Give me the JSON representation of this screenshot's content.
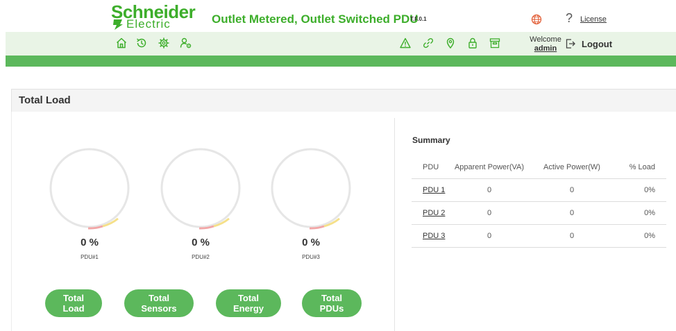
{
  "header": {
    "logo_line1": "Schneider",
    "logo_line2": "Electric",
    "product_title": "Outlet Metered, Outlet Switched PDU",
    "version": "T.F.0.1",
    "help_symbol": "?",
    "license_label": "License"
  },
  "nav": {
    "left_icons": [
      "home-icon",
      "history-icon",
      "settings-gear-icon",
      "user-settings-icon"
    ],
    "right_icons": [
      "alarm-warning-icon",
      "link-icon",
      "location-pin-icon",
      "lock-icon",
      "archive-icon"
    ],
    "welcome_label": "Welcome",
    "user": "admin",
    "logout_label": "Logout"
  },
  "panel": {
    "title": "Total Load"
  },
  "gauges": [
    {
      "value": "0 %",
      "label": "PDU#1"
    },
    {
      "value": "0 %",
      "label": "PDU#2"
    },
    {
      "value": "0 %",
      "label": "PDU#3"
    }
  ],
  "buttons": [
    {
      "line1": "Total",
      "line2": "Load"
    },
    {
      "line1": "Total",
      "line2": "Sensors"
    },
    {
      "line1": "Total",
      "line2": "Energy"
    },
    {
      "line1": "Total",
      "line2": "PDUs"
    }
  ],
  "summary": {
    "title": "Summary",
    "columns": [
      "PDU",
      "Apparent Power(VA)",
      "Active Power(W)",
      "% Load"
    ],
    "rows": [
      {
        "pdu": "PDU 1",
        "apparent": "0",
        "active": "0",
        "load": "0%"
      },
      {
        "pdu": "PDU 2",
        "apparent": "0",
        "active": "0",
        "load": "0%"
      },
      {
        "pdu": "PDU 3",
        "apparent": "0",
        "active": "0",
        "load": "0%"
      }
    ]
  },
  "colors": {
    "brand_green": "#3dae2b",
    "strip_green": "#5cb85c",
    "nav_bg": "#e9f4e6",
    "gauge_ring": "#e6e6e6",
    "gauge_red": "#f2a7a7",
    "gauge_yellow": "#f5e08a"
  }
}
